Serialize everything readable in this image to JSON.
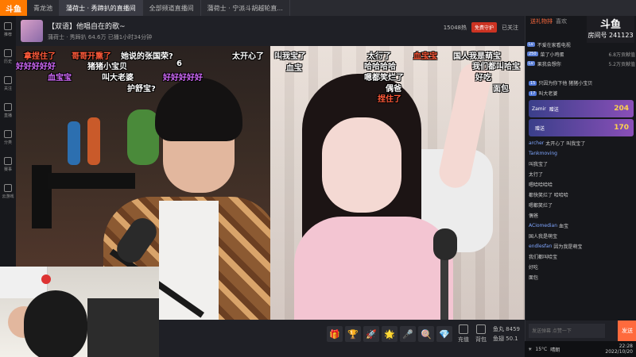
{
  "app": {
    "logo": "斗鱼"
  },
  "tabs": [
    {
      "label": "青龙池"
    },
    {
      "label": "蒲荷士 · 秀蹄扒的直播间"
    },
    {
      "label": "全部频道直播间"
    },
    {
      "label": "蒲荷士 · 宁派斗胡越轮直..."
    }
  ],
  "sidebar": {
    "items": [
      {
        "label": "推荐"
      },
      {
        "label": "历史"
      },
      {
        "label": "关注"
      },
      {
        "label": "直播"
      },
      {
        "label": "分类"
      },
      {
        "label": "赛事"
      },
      {
        "label": "云游戏"
      }
    ]
  },
  "room": {
    "title": "【双语】他唱自在的歌~",
    "meta": "蒲荷士 · 秀蹄扒  64.6万  已播1小时34分钟",
    "fans": "15048热",
    "badge": "免费守护",
    "follow": "已关注"
  },
  "danmaku": [
    {
      "text": "拿捏住了",
      "color": "#ff5a3a"
    },
    {
      "text": "哥哥开熏了",
      "color": "#ff5a3a"
    },
    {
      "text": "她说的张国荣?",
      "color": "#ffffff"
    },
    {
      "text": "太开心了",
      "color": "#ffffff"
    },
    {
      "text": "叫我宝了",
      "color": "#ffffff"
    },
    {
      "text": "太行了",
      "color": "#ffffff"
    },
    {
      "text": "血宝宝",
      "color": "#ff5a3a"
    },
    {
      "text": "国人我是萌宝",
      "color": "#ffffff"
    },
    {
      "text": "好好好好好",
      "color": "#d46bff"
    },
    {
      "text": "猪猪小宝贝",
      "color": "#ffffff"
    },
    {
      "text": "6",
      "color": "#ffffff"
    },
    {
      "text": "血宝",
      "color": "#ffffff"
    },
    {
      "text": "哈哈哈哈",
      "color": "#ffffff"
    },
    {
      "text": "我们都叫哈宝",
      "color": "#ffffff"
    },
    {
      "text": "血宝宝",
      "color": "#d46bff"
    },
    {
      "text": "叫大老婆",
      "color": "#ffffff"
    },
    {
      "text": "好好好好好",
      "color": "#d46bff"
    },
    {
      "text": "嗯都笑烂了",
      "color": "#ffffff"
    },
    {
      "text": "好吃",
      "color": "#ffffff"
    },
    {
      "text": "护舒宝?",
      "color": "#ffffff"
    },
    {
      "text": "偶爸",
      "color": "#ffffff"
    },
    {
      "text": "面包",
      "color": "#ffffff"
    },
    {
      "text": "捏住了",
      "color": "#ff5a3a"
    }
  ],
  "giftbar": {
    "gifts": [
      "🎁",
      "🏆",
      "🚀",
      "🌟",
      "🎤",
      "🍭",
      "💎"
    ],
    "buttons": [
      {
        "label": "充值"
      },
      {
        "label": "背包"
      }
    ],
    "balance": "鱼丸 8459",
    "fishball": "鱼翅 50.1"
  },
  "chat": {
    "tabs": [
      {
        "label": "送礼物排",
        "on": true
      },
      {
        "label": "喜欢"
      }
    ],
    "room_logo": "斗鱼",
    "room_no_label": "房间号",
    "room_no": "241123",
    "rank": [
      {
        "lvl": "Lv",
        "name": "不爱在家看电视",
        "count": ""
      },
      {
        "lvl": "250",
        "name": "菜了小鸡蛋",
        "count": "6.8万贡献值"
      },
      {
        "lvl": "Lv",
        "name": "果我会想你",
        "count": "5.2万贡献值"
      }
    ],
    "messages": [
      {
        "lv": "15",
        "tag": "",
        "name": "",
        "text": "只因为你下他  猪猪小宝贝"
      },
      {
        "lv": "17",
        "tag": "",
        "name": "",
        "text": "叫大老婆"
      },
      {
        "lv": "",
        "tag": "",
        "name": "Zamir",
        "text": "赠送",
        "banner": true,
        "val": "204"
      },
      {
        "lv": "",
        "tag": "",
        "name": "",
        "text": "赠送",
        "banner": true,
        "val": "170"
      },
      {
        "lv": "",
        "tag": "",
        "name": "archer",
        "text": "太开心了  叫我宝了"
      },
      {
        "lv": "",
        "tag": "",
        "name": "Tankmoving",
        "text": ""
      },
      {
        "lv": "",
        "tag": "",
        "name": "",
        "text": "叫我宝了"
      },
      {
        "lv": "",
        "tag": "",
        "name": "",
        "text": "太行了"
      },
      {
        "lv": "",
        "tag": "",
        "name": "",
        "text": "嗯哈哈哈哈"
      },
      {
        "lv": "",
        "tag": "",
        "name": "",
        "text": "都快笑烂了 哈哈哈"
      },
      {
        "lv": "",
        "tag": "",
        "name": "",
        "text": "嗯都笑烂了"
      },
      {
        "lv": "",
        "tag": "",
        "name": "",
        "text": "偶爸"
      },
      {
        "lv": "",
        "tag": "",
        "name": "ACiomedian",
        "text": "血宝"
      },
      {
        "lv": "",
        "tag": "",
        "name": "",
        "text": "国人我是萌宝"
      },
      {
        "lv": "",
        "tag": "",
        "name": "endlesfan",
        "text": "因为我是萌宝"
      },
      {
        "lv": "",
        "tag": "",
        "name": "",
        "text": "我们都叫哈宝"
      },
      {
        "lv": "",
        "tag": "",
        "name": "",
        "text": "好吃"
      },
      {
        "lv": "",
        "tag": "",
        "name": "",
        "text": "面包"
      }
    ],
    "input_placeholder": "发送弹幕 点赞一下",
    "send": "发送"
  },
  "taskbar": {
    "temp": "15°C",
    "weather": "晴朗",
    "time": "22:28",
    "date": "2022/10/20"
  }
}
